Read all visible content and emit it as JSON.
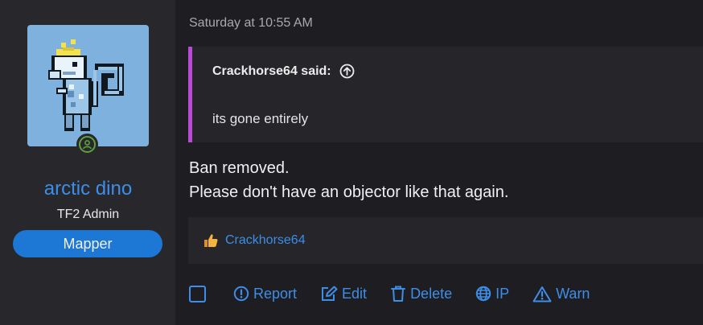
{
  "post": {
    "timestamp": "Saturday at 10:55 AM",
    "message_lines": [
      "Ban removed.",
      "Please don't have an objector like that again."
    ]
  },
  "user": {
    "name": "arctic dino",
    "title": "TF2 Admin",
    "banner": "Mapper",
    "status": "online"
  },
  "quote": {
    "author": "Crackhorse64 said:",
    "text": "its gone entirely"
  },
  "reactions": {
    "icon": "thumbs-up-icon",
    "users": "Crackhorse64"
  },
  "actions": {
    "report": "Report",
    "edit": "Edit",
    "delete": "Delete",
    "ip": "IP",
    "warn": "Warn"
  },
  "colors": {
    "accent": "#3d8ee8",
    "quote_border": "#b94bd6",
    "banner": "#1d77d4",
    "online": "#5ca33a"
  }
}
